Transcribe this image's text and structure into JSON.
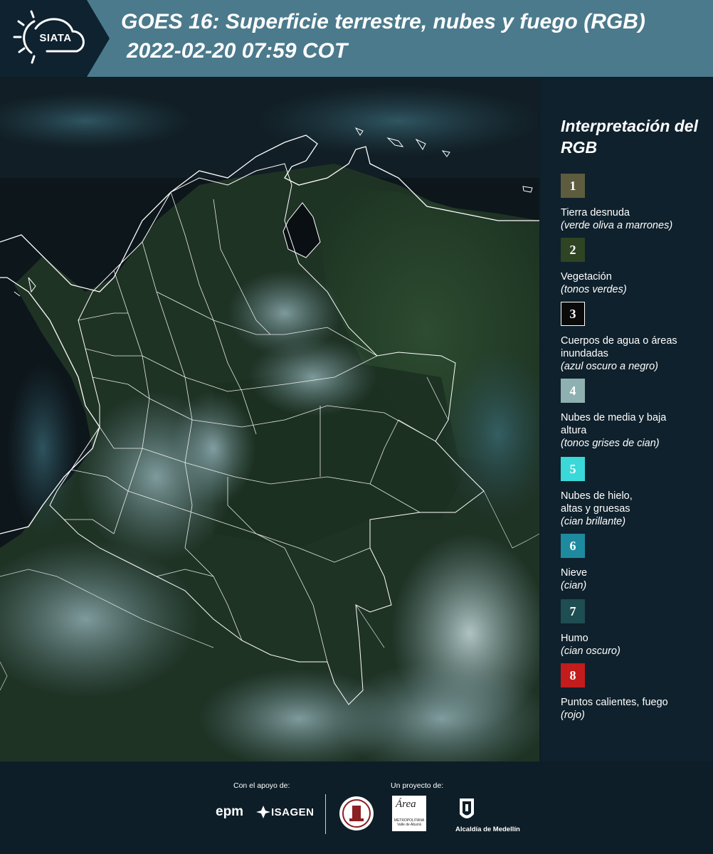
{
  "header": {
    "logo_text": "SIATA",
    "title_line1": "GOES 16: Superficie terrestre, nubes y fuego (RGB)",
    "title_line2": "2022-02-20 07:59 COT"
  },
  "legend": {
    "title": "Interpretación del RGB",
    "items": [
      {
        "number": "1",
        "color": "#5e5c3f",
        "label": "Tierra desnuda",
        "sub": "(verde oliva a marrones)"
      },
      {
        "number": "2",
        "color": "#2e4423",
        "label": "Vegetación",
        "sub": "(tonos verdes)"
      },
      {
        "number": "3",
        "color": "#0a0a0a",
        "label": "Cuerpos de agua o áreas inundadas",
        "sub": "(azul oscuro a negro)"
      },
      {
        "number": "4",
        "color": "#8fb0b1",
        "label": "Nubes de media y baja altura",
        "sub": "(tonos grises de cian)"
      },
      {
        "number": "5",
        "color": "#3ad8d8",
        "label": "Nubes de hielo, altas y gruesas",
        "sub": "(cian brillante)"
      },
      {
        "number": "6",
        "color": "#1e8aa0",
        "label": "Nieve",
        "sub": "(cian)"
      },
      {
        "number": "7",
        "color": "#1e4d52",
        "label": "Humo",
        "sub": "(cian oscuro)"
      },
      {
        "number": "8",
        "color": "#c21c1c",
        "label": "Puntos calientes, fuego",
        "sub": "(rojo)"
      }
    ]
  },
  "footer": {
    "support_label": "Con el apoyo de:",
    "project_label": "Un proyecto de:",
    "epm": "epm",
    "isagen": "ISAGEN",
    "area_logo": "Área",
    "area_sub": "METROPOLITANA Valle de Aburrá",
    "alcaldia": "Alcaldía de Medellín"
  }
}
